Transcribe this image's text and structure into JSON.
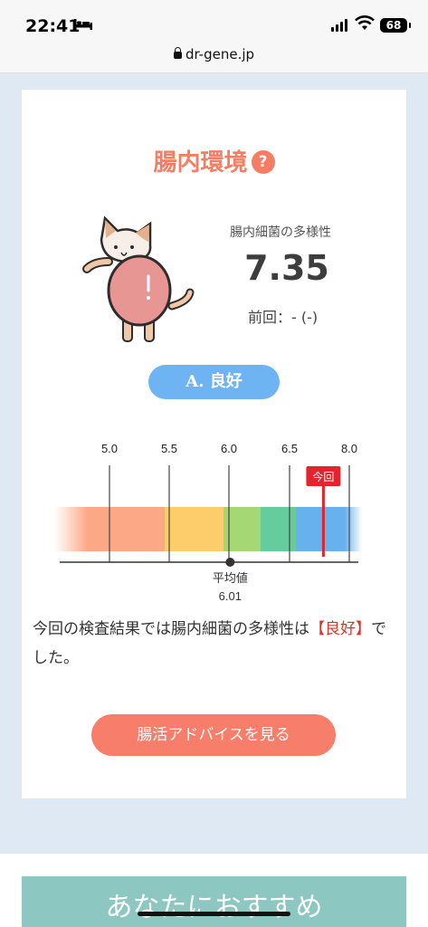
{
  "status_bar": {
    "time": "22:41",
    "battery": "68",
    "icons": [
      "bed-icon",
      "signal-icon",
      "wifi-icon",
      "battery-icon"
    ]
  },
  "browser": {
    "url": "dr-gene.jp",
    "lock_icon": "lock-icon"
  },
  "section": {
    "title": "腸内環境",
    "help_icon": "?",
    "metric_label": "腸内細菌の多様性",
    "metric_value": "7.35",
    "previous": "前回：- (-)",
    "grade": "A. 良好"
  },
  "gauge": {
    "ticks": [
      "5.0",
      "5.5",
      "6.0",
      "6.5",
      "8.0"
    ],
    "current_label": "今回",
    "average_label": "平均値",
    "average_value": "6.01",
    "current_value": 7.35,
    "average": 6.01,
    "colors": [
      "#fca886",
      "#fdcd6b",
      "#a5d874",
      "#64cc9d",
      "#68b1ef"
    ],
    "marker_color": "#e4232c"
  },
  "summary": {
    "text_before": "今回の検査結果では腸内細菌の多様性は",
    "highlight": "【良好】",
    "text_after": "でした。"
  },
  "advice_button": "腸活アドバイスを見る",
  "recommend_banner": "あなたにおすすめ"
}
